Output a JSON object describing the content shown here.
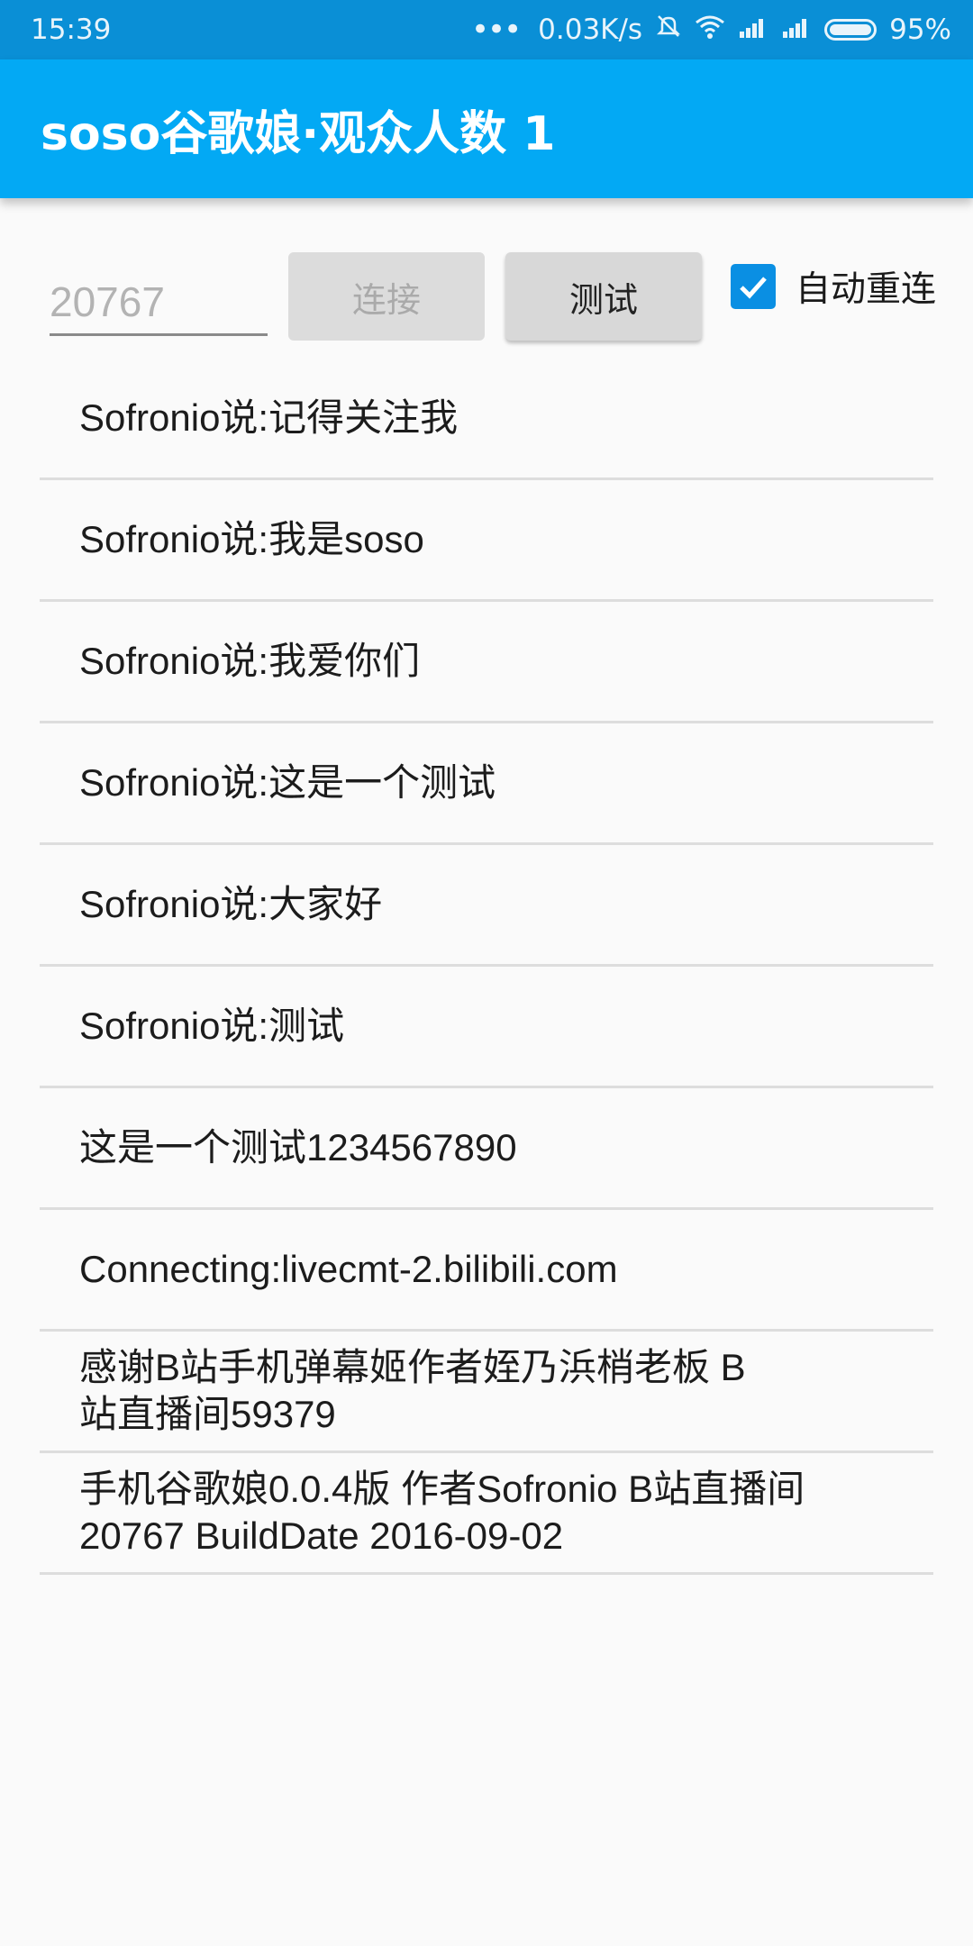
{
  "status_bar": {
    "time": "15:39",
    "network_speed": "0.03K/s",
    "battery_percent": "95%",
    "icons": [
      "more-dots-icon",
      "mute-icon",
      "wifi-icon",
      "signal-icon",
      "signal-icon",
      "battery-icon"
    ]
  },
  "app_bar": {
    "title": "soso谷歌娘·观众人数 1"
  },
  "controls": {
    "room_input_placeholder": "20767",
    "connect_label": "连接",
    "test_label": "测试",
    "auto_reconnect_label": "自动重连",
    "auto_reconnect_checked": true
  },
  "messages": [
    "Sofronio说:记得关注我",
    "Sofronio说:我是soso",
    "Sofronio说:我爱你们",
    "Sofronio说:这是一个测试",
    "Sofronio说:大家好",
    "Sofronio说:测试",
    "这是一个测试1234567890",
    "Connecting:livecmt-2.bilibili.com",
    "感谢B站手机弹幕姬作者姪乃浜梢老板 B\n站直播间59379",
    "手机谷歌娘0.0.4版 作者Sofronio B站直播间\n20767 BuildDate 2016-09-02"
  ],
  "colors": {
    "status_bar": "#0a8fd6",
    "app_bar": "#03a9f4",
    "checkbox": "#0a8fe3"
  }
}
